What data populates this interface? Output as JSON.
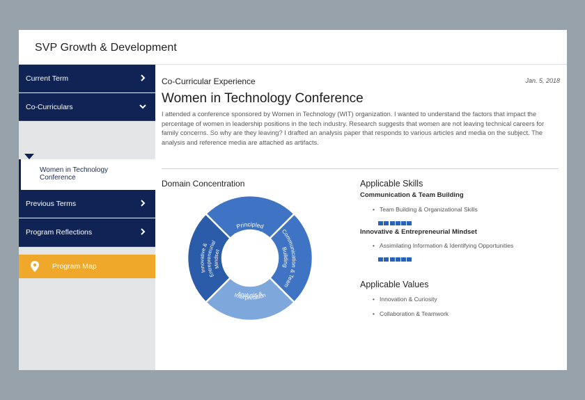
{
  "header": {
    "title": "SVP Growth & Development"
  },
  "sidebar": {
    "current_term": "Current Term",
    "co_curriculars": "Co-Curriculars",
    "sub_item": "Women in Technology Conference",
    "previous_terms": "Previous Terms",
    "program_reflections": "Program Reflections",
    "program_map": "Program Map"
  },
  "content": {
    "section_type": "Co-Curricular Experience",
    "date": "Jan. 5, 2018",
    "title": "Women in Technology Conference",
    "body": "I attended a conference sponsored by Women in Technology (WIT) organization. I wanted to understand the factors that impact the percentage of women in leadership positions in the tech industry. Research suggests that women are not leaving technical careers for family concerns. So why are they leaving? I drafted an analysis paper that responds to various articles and media on the subject. The analysis and reference media are attached as artifacts.",
    "domain_title": "Domain Concentration",
    "wheel": {
      "top": "Principled Leadership",
      "right": "Communication & Team Building",
      "bottom": "Analysis & Interpretation",
      "left": "Innovative & Entrepreneurial Mindset"
    },
    "skills_title": "Applicable Skills",
    "skills": [
      {
        "heading": "Communication & Team Building",
        "item": "Team Building & Organizational Skills",
        "level": 6
      },
      {
        "heading": "Innovative & Entrepreneurial Mindset",
        "item": "Assimilating Information & Identifying Opportunities",
        "level": 6
      }
    ],
    "values_title": "Applicable Values",
    "values": [
      "Innovation & Curiosity",
      "Collaboration & Teamwork"
    ]
  },
  "colors": {
    "navy": "#0f2354",
    "accent": "#f0a82b",
    "wheel_dark": "#2a5caa",
    "wheel_mid": "#3f73c4",
    "wheel_light": "#7ea7dc"
  }
}
